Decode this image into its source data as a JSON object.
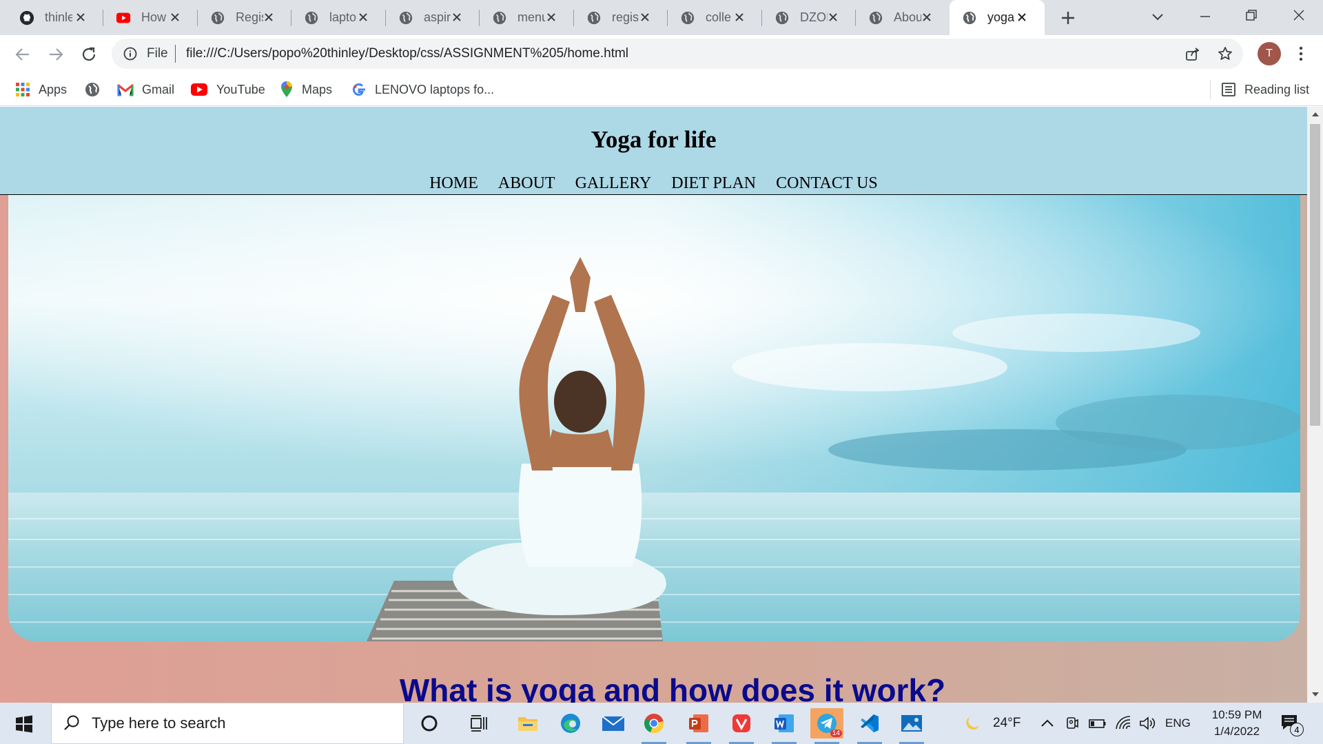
{
  "browser": {
    "tabs": [
      {
        "title": "thinley",
        "icon": "github-icon"
      },
      {
        "title": "How",
        "icon": "youtube-icon"
      },
      {
        "title": "Regis",
        "icon": "globe-icon"
      },
      {
        "title": "lapto",
        "icon": "globe-icon"
      },
      {
        "title": "aspir",
        "icon": "globe-icon"
      },
      {
        "title": "menu",
        "icon": "globe-icon"
      },
      {
        "title": "regis",
        "icon": "globe-icon"
      },
      {
        "title": "colle",
        "icon": "globe-icon"
      },
      {
        "title": "DZOI",
        "icon": "globe-icon"
      },
      {
        "title": "Abou",
        "icon": "globe-icon"
      },
      {
        "title": "yoga",
        "icon": "globe-icon",
        "active": true
      }
    ],
    "address": {
      "scheme_label": "File",
      "url": "file:///C:/Users/popo%20thinley/Desktop/css/ASSIGNMENT%205/home.html"
    },
    "profile_initial": "T",
    "bookmarks": [
      {
        "label": "Apps",
        "icon": "apps-grid-icon"
      },
      {
        "label": "",
        "icon": "globe-icon"
      },
      {
        "label": "Gmail",
        "icon": "gmail-icon"
      },
      {
        "label": "YouTube",
        "icon": "youtube-icon"
      },
      {
        "label": "Maps",
        "icon": "maps-icon"
      },
      {
        "label": "LENOVO laptops fo...",
        "icon": "google-icon"
      }
    ],
    "reading_list_label": "Reading list"
  },
  "page": {
    "site_title": "Yoga for life",
    "nav": [
      "HOME",
      "ABOUT",
      "GALLERY",
      "DIET PLAN",
      "CONTACT US"
    ],
    "section_heading": "What is yoga and how does it work?",
    "colors": {
      "header_bg": "#add8e6",
      "heading_color": "#0a0a8c",
      "body_gradient_left": "#df9f95",
      "body_gradient_right": "#c8b0a4"
    }
  },
  "taskbar": {
    "search_placeholder": "Type here to search",
    "weather": "24°F",
    "language": "ENG",
    "time": "10:59 PM",
    "date": "1/4/2022",
    "notification_count": "4",
    "telegram_badge": "14"
  }
}
